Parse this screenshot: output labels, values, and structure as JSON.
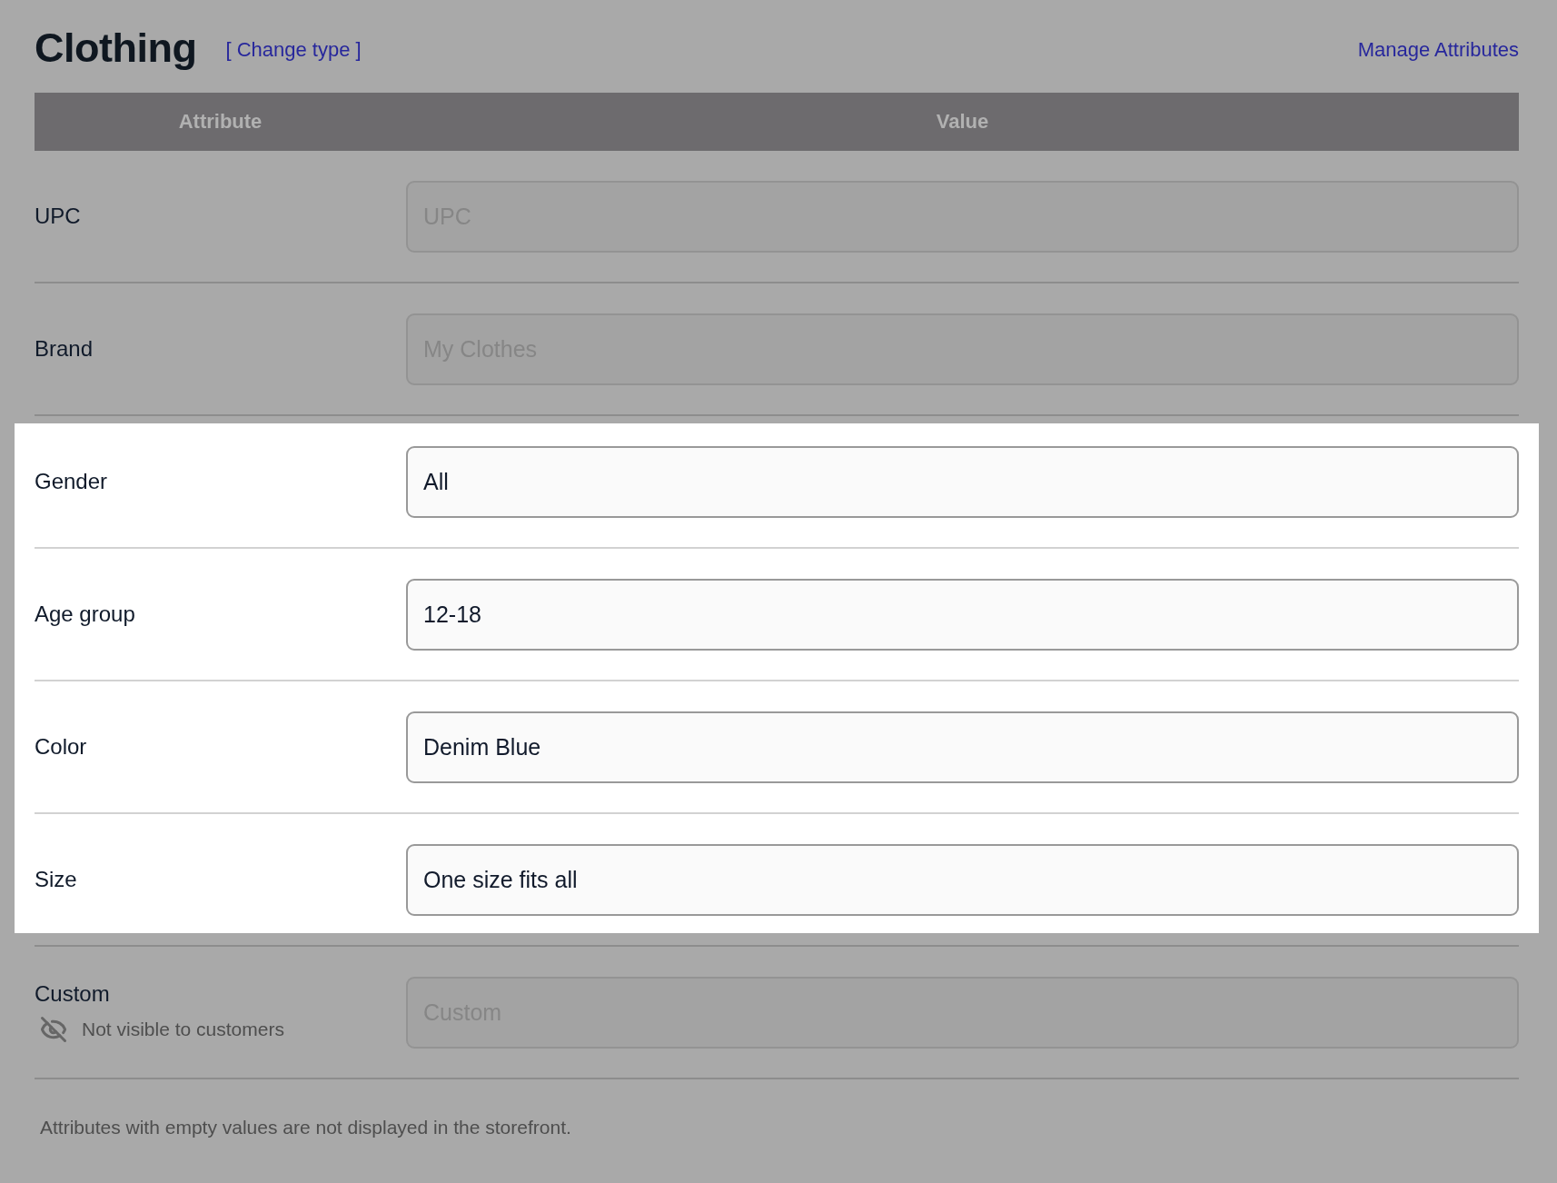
{
  "header": {
    "title": "Clothing",
    "change_type_link": "[ Change type ]",
    "manage_link": "Manage Attributes"
  },
  "table": {
    "columns": [
      "Attribute",
      "Value"
    ],
    "rows": [
      {
        "label": "UPC",
        "placeholder": "UPC",
        "highlighted": false
      },
      {
        "label": "Brand",
        "placeholder": "My Clothes",
        "highlighted": false
      },
      {
        "label": "Gender",
        "value": "All",
        "highlighted": true
      },
      {
        "label": "Age group",
        "value": "12-18",
        "highlighted": true
      },
      {
        "label": "Color",
        "value": "Denim Blue",
        "highlighted": true
      },
      {
        "label": "Size",
        "value": "One size fits all",
        "highlighted": true
      },
      {
        "label": "Custom",
        "placeholder": "Custom",
        "note": "Not visible to customers",
        "highlighted": false
      }
    ]
  },
  "footer_note": "Attributes with empty values are not displayed in the storefront."
}
